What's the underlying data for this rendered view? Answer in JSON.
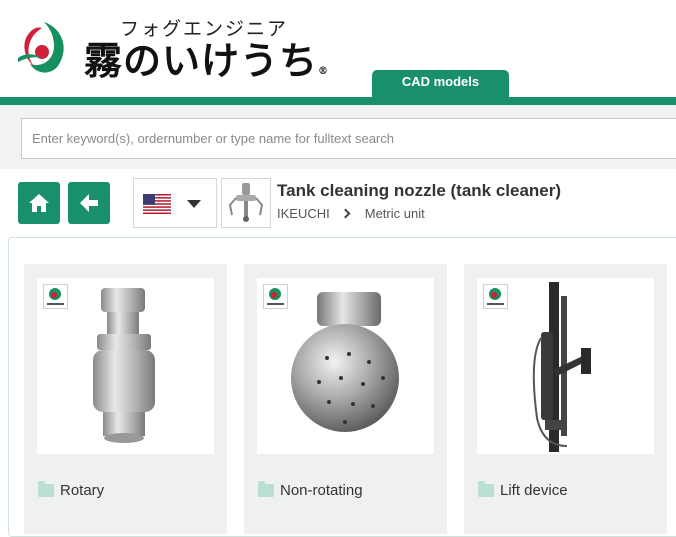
{
  "header": {
    "logo_sub": "フォグエンジニア",
    "logo_main": "霧のいけうち",
    "logo_reg": "®",
    "cad_tab": "CAD models"
  },
  "search": {
    "placeholder": "Enter keyword(s), ordernumber or type name for fulltext search"
  },
  "nav": {
    "category_title": "Tank cleaning nozzle (tank cleaner)",
    "breadcrumb": [
      "IKEUCHI",
      "Metric unit"
    ],
    "language_flag": "us-flag-icon"
  },
  "cards": [
    {
      "label": "Rotary",
      "image": "rotary-nozzle-image"
    },
    {
      "label": "Non-rotating",
      "image": "ball-nozzle-image"
    },
    {
      "label": "Lift device",
      "image": "lift-device-image"
    }
  ],
  "colors": {
    "brand_green": "#1a8f6d",
    "folder": "#b9dfd0",
    "card_bg": "#eef0f1"
  }
}
